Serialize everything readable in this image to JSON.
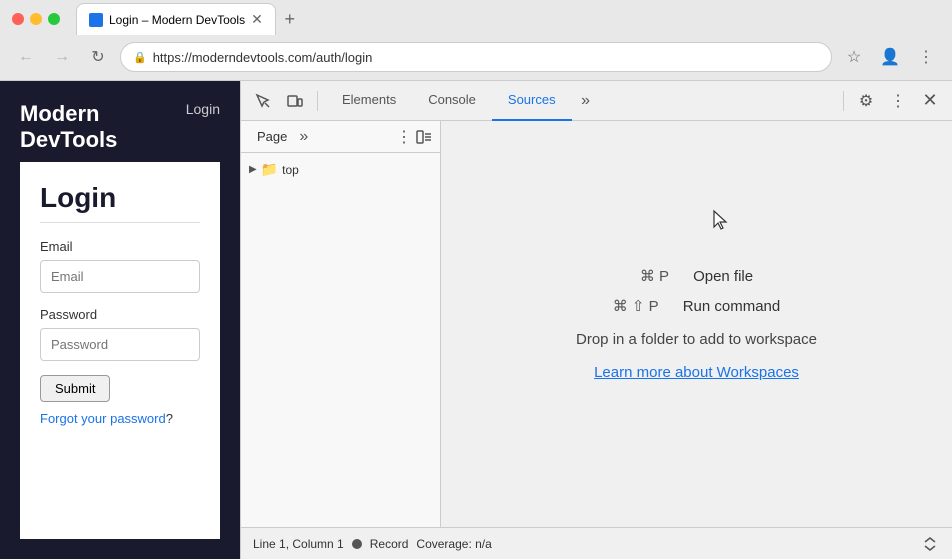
{
  "browser": {
    "title": "Login – Modern DevTools",
    "url": "https://moderndevtools.com/auth/login",
    "new_tab_label": "+",
    "nav_back": "←",
    "nav_forward": "→",
    "nav_refresh": "↻"
  },
  "webpage": {
    "logo_line1": "Modern",
    "logo_line2": "DevTools",
    "nav_login": "Login",
    "login_title": "Login",
    "email_label": "Email",
    "email_placeholder": "Email",
    "password_label": "Password",
    "password_placeholder": "Password",
    "submit_label": "Submit",
    "forgot_text": "Forgot your password",
    "forgot_suffix": "?"
  },
  "devtools": {
    "tabs": [
      "Elements",
      "Console",
      "Sources",
      "»"
    ],
    "active_tab": "Sources",
    "settings_icon": "⚙",
    "kebab_icon": "⋮",
    "close_icon": "✕",
    "sources": {
      "sidebar_tab": "Page",
      "sidebar_more": "»",
      "file_tree_item": "top",
      "shortcut1_key": "⌘ P",
      "shortcut1_label": "Open file",
      "shortcut2_key": "⌘ ⇧ P",
      "shortcut2_label": "Run command",
      "drop_hint": "Drop in a folder to add to workspace",
      "workspace_link": "Learn more about Workspaces"
    },
    "statusbar": {
      "position": "Line 1, Column 1",
      "record_label": "Record",
      "coverage_label": "Coverage: n/a"
    }
  }
}
